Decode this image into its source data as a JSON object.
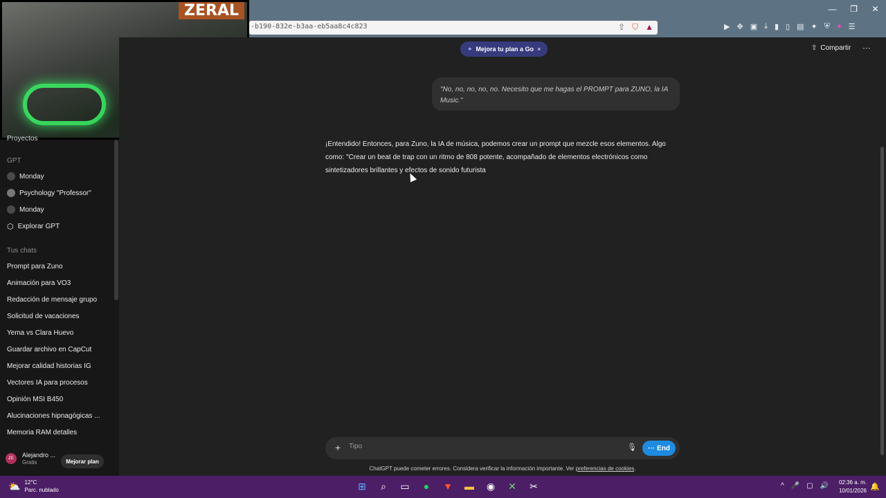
{
  "browser": {
    "url": "-b190-832e-b3aa-eb5aa8c4c823",
    "minimize": "—",
    "restore": "❐",
    "close": "✕"
  },
  "webcam": {
    "overlay_text": "ZERAL"
  },
  "sidebar": {
    "projects_label": "Proyectos",
    "gpt_section": "GPT",
    "gpt_items": [
      {
        "label": "Monday"
      },
      {
        "label": "Psychology \"Professor\""
      },
      {
        "label": "Monday"
      },
      {
        "label": "Explorar GPT"
      }
    ],
    "chats_section": "Tus chats",
    "chats": [
      {
        "label": "Prompt para Zuno"
      },
      {
        "label": "Animación para VO3"
      },
      {
        "label": "Redacción de mensaje grupo"
      },
      {
        "label": "Solicitud de vacaciones"
      },
      {
        "label": "Yema vs Clara Huevo"
      },
      {
        "label": "Guardar archivo en CapCut"
      },
      {
        "label": "Mejorar calidad historias IG"
      },
      {
        "label": "Vectores IA para procesos"
      },
      {
        "label": "Opinión MSI B450"
      },
      {
        "label": "Alucinaciones hipnagógicas ..."
      },
      {
        "label": "Memoria RAM detalles"
      }
    ],
    "user": {
      "initials": "ZE",
      "name": "Alejandro ...",
      "plan": "Gratis"
    },
    "upgrade_label": "Mejorar plan"
  },
  "header": {
    "promo_label": "Mejora tu plan a Go",
    "promo_close": "×",
    "share_label": "Compartir",
    "more_label": "···"
  },
  "conversation": {
    "user_message": "\"No, no, no, no, no. Necesito que me hagas el PROMPT para ZUNO, la IA Music.\"",
    "assistant_message": "¡Entendido! Entonces, para Zuno, la IA de música, podemos crear un prompt que mezcle esos elementos. Algo como: \"Crear un beat de trap con un ritmo de 808 potente, acompañado de elementos electrónicos como sintetizadores brillantes y efectos de sonido futurista"
  },
  "composer": {
    "placeholder": "Tipo",
    "end_label": "End"
  },
  "disclaimer": {
    "text": "ChatGPT puede cometer errores. Considera verificar la información importante. Ver ",
    "link": "preferencias de cookies",
    "suffix": "."
  },
  "taskbar": {
    "temperature": "12°C",
    "weather": "Parc. nublado",
    "time": "02:36 a. m.",
    "date": "10/01/2026"
  },
  "colors": {
    "accent": "#1e8be0",
    "promo_bg": "#373a7c",
    "taskbar": "#4b1e66"
  }
}
